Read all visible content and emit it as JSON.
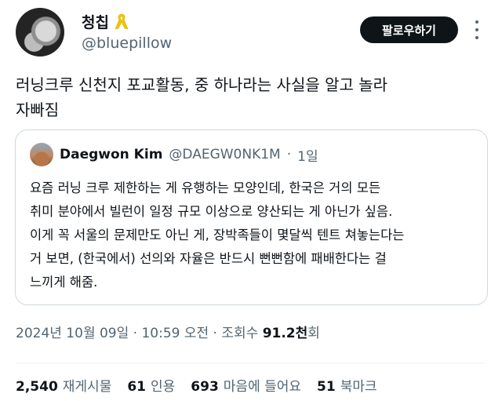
{
  "author": {
    "display_name": "청칩",
    "handle": "@bluepillow",
    "ribbon_color": "#f5c400"
  },
  "actions": {
    "follow_label": "팔로우하기",
    "more_icon": "more-vertical-icon"
  },
  "tweet": {
    "text_line1": "러닝크루 신천지 포교활동, 중 하나라는 사실을 알고 놀라",
    "text_line2": "자빠짐"
  },
  "quote": {
    "name": "Daegwon Kim",
    "handle": "@DAEGW0NK1M",
    "dot": "·",
    "time": "1일",
    "lines": [
      "요즘 러닝 크루 제한하는 게 유행하는 모양인데, 한국은 거의 모든",
      "취미 분야에서 빌런이 일정 규모 이상으로 양산되는 게 아닌가 싶음.",
      "이게 꼭 서울의 문제만도 아닌 게, 장박족들이 몇달씩 텐트 쳐놓는다는",
      "거 보면, (한국에서) 선의와 자율은 반드시 뻔뻔함에 패배한다는 걸",
      "느끼게 해줌."
    ]
  },
  "meta": {
    "datetime": "2024년 10월 09일 · 10:59 오전 · 조회수 ",
    "views_count": "91.2천",
    "views_suffix": "회"
  },
  "stats": {
    "reposts_value": "2,540",
    "reposts_label": "재게시물",
    "quotes_value": "61",
    "quotes_label": "인용",
    "likes_value": "693",
    "likes_label": "마음에 들어요",
    "bookmarks_value": "51",
    "bookmarks_label": "북마크"
  }
}
